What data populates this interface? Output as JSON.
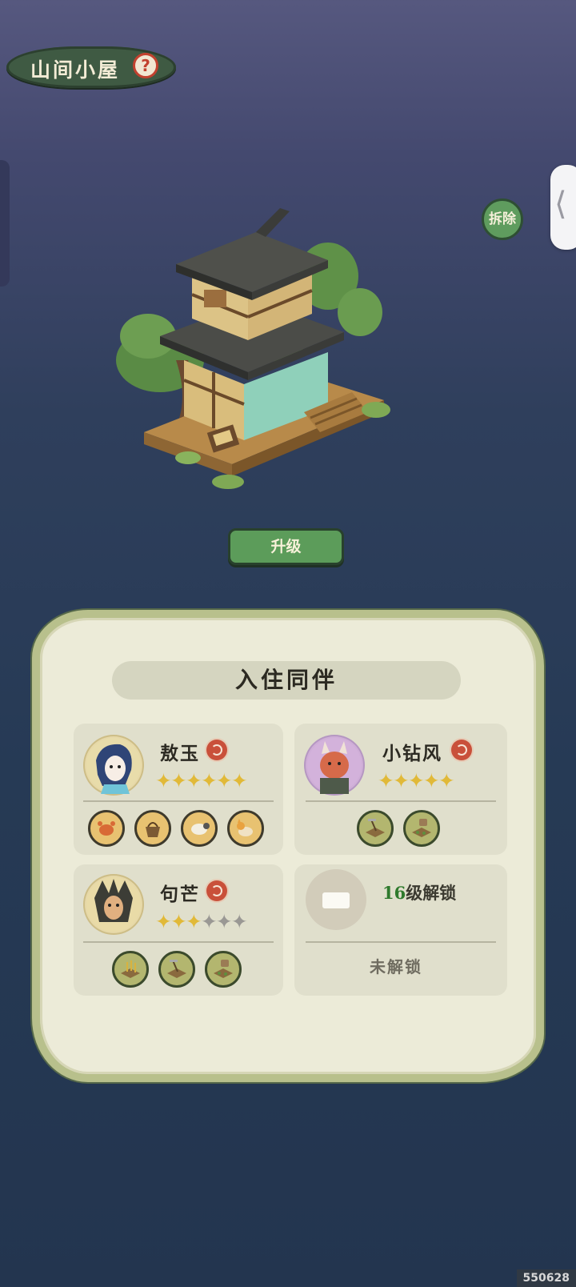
{
  "header": {
    "title": "山间小屋",
    "help_icon": "?"
  },
  "side_tab": {
    "chevron": "⟨"
  },
  "actions": {
    "demolish": "拆除",
    "upgrade": "升级"
  },
  "panel": {
    "title": "入住同伴",
    "companions": [
      {
        "name": "敖玉",
        "stars_filled": 6,
        "stars_total": 6,
        "skills": [
          "crab-icon",
          "basket-icon",
          "sheep-icon",
          "cat-icon"
        ]
      },
      {
        "name": "小钻风",
        "stars_filled": 5,
        "stars_total": 5,
        "skills": [
          "hoe-field-icon",
          "watering-can-field-icon"
        ]
      },
      {
        "name": "句芒",
        "stars_filled": 3,
        "stars_total": 6,
        "skills": [
          "wheat-field-icon",
          "hoe-field-icon",
          "watering-can-field-icon"
        ]
      }
    ],
    "locked_slot": {
      "level": "16",
      "level_suffix": "级解锁",
      "status": "未解锁"
    }
  },
  "build_id": "550628",
  "colors": {
    "accent_green": "#5c9c5a",
    "star": "#e1b938",
    "element_red": "#c9503a"
  }
}
